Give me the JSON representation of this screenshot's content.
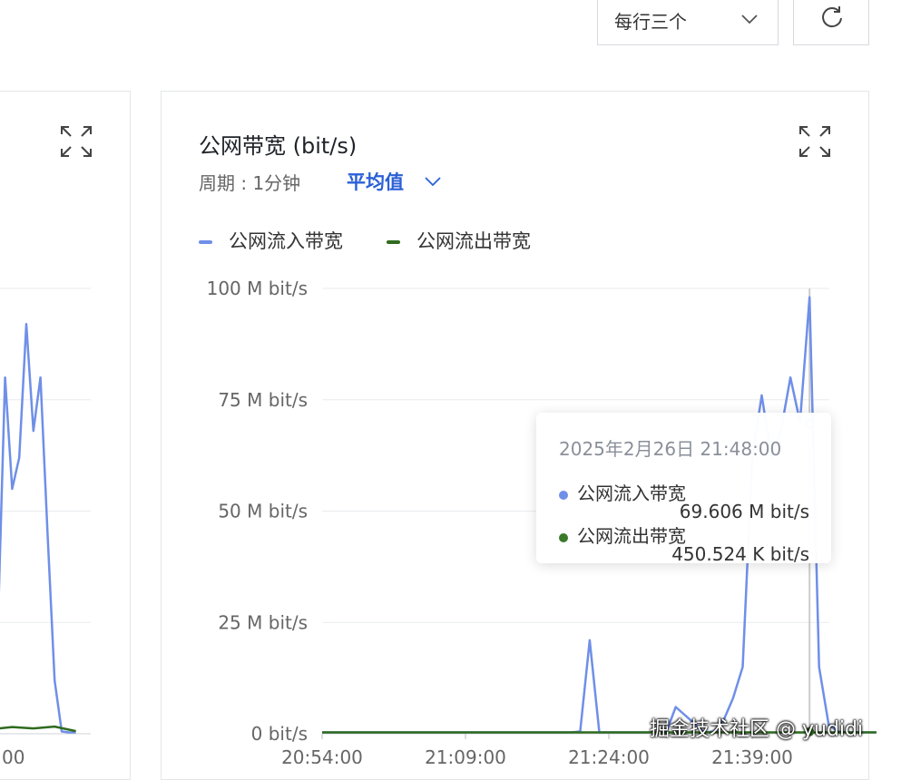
{
  "toolbar": {
    "layout_select_value": "每行三个",
    "refresh_icon": "refresh-icon",
    "chevron_icon": "chevron-down-icon"
  },
  "card": {
    "title": "公网带宽 (bit/s)",
    "period_label": "周期 : 1分钟",
    "aggregation": "平均值",
    "expand_icon": "expand-icon"
  },
  "tooltip": {
    "time": "2025年2月26日 21:48:00",
    "rows": [
      {
        "name": "公网流入带宽",
        "value": "69.606 M bit/s",
        "color": "#6f8fe8"
      },
      {
        "name": "公网流出带宽",
        "value": "450.524 K bit/s",
        "color": "#3a7a2a"
      }
    ]
  },
  "watermark": "掘金技术社区 @ yudidi",
  "colors": {
    "inbound": "#6f8fe8",
    "outbound": "#2f6b1f",
    "accent": "#2a5fd6",
    "grid": "#e9ebee"
  },
  "chart_data": [
    {
      "type": "line",
      "title": "公网带宽 (bit/s)",
      "ylabel": "",
      "xlabel": "",
      "unit": "bit/s",
      "ylim": [
        0,
        100
      ],
      "y_ticks": [
        "0  bit/s",
        "25 M bit/s",
        "50 M bit/s",
        "75 M bit/s",
        "100 M bit/s"
      ],
      "x_ticks": [
        "20:54:00",
        "21:09:00",
        "21:24:00",
        "21:39:00"
      ],
      "x_tick_minutes": [
        0,
        15,
        30,
        45
      ],
      "x_range_minutes": [
        0,
        58
      ],
      "legend": [
        "公网流入带宽",
        "公网流出带宽"
      ],
      "legend_position": "top-left",
      "grid": true,
      "series": [
        {
          "name": "公网流入带宽",
          "color": "#6f8fe8",
          "x": [
            0,
            26,
            27,
            28,
            29,
            35,
            36,
            37,
            40,
            41,
            42,
            43,
            44,
            45,
            46,
            47,
            48,
            49,
            50,
            51,
            52,
            53,
            54,
            55,
            56,
            57,
            58
          ],
          "y": [
            0.3,
            0.3,
            0.5,
            21,
            0.3,
            0.3,
            0.3,
            6,
            0.3,
            0.5,
            3,
            8,
            15,
            62,
            76,
            62,
            68,
            80,
            70,
            98,
            15,
            2,
            0.5,
            0.3,
            0.3,
            0.3,
            0.3
          ]
        },
        {
          "name": "公网流出带宽",
          "color": "#2f6b1f",
          "x": [
            0,
            58
          ],
          "y": [
            0.3,
            0.3
          ]
        }
      ]
    },
    {
      "type": "line",
      "title": "",
      "partial": true,
      "ylim": [
        0,
        100
      ],
      "x_ticks": [
        "00"
      ],
      "series": [
        {
          "name": "公网流入带宽",
          "color": "#6f8fe8",
          "x": [
            0,
            1,
            2,
            3,
            4,
            5,
            6,
            7,
            8,
            9,
            10,
            11,
            12
          ],
          "y": [
            5,
            25,
            80,
            55,
            62,
            92,
            68,
            80,
            45,
            12,
            0.5,
            0.3,
            0.3
          ]
        },
        {
          "name": "公网流出带宽",
          "color": "#2f6b1f",
          "x": [
            0,
            3,
            6,
            9,
            12
          ],
          "y": [
            1,
            1.5,
            1.2,
            1.6,
            0.6
          ]
        }
      ]
    }
  ]
}
